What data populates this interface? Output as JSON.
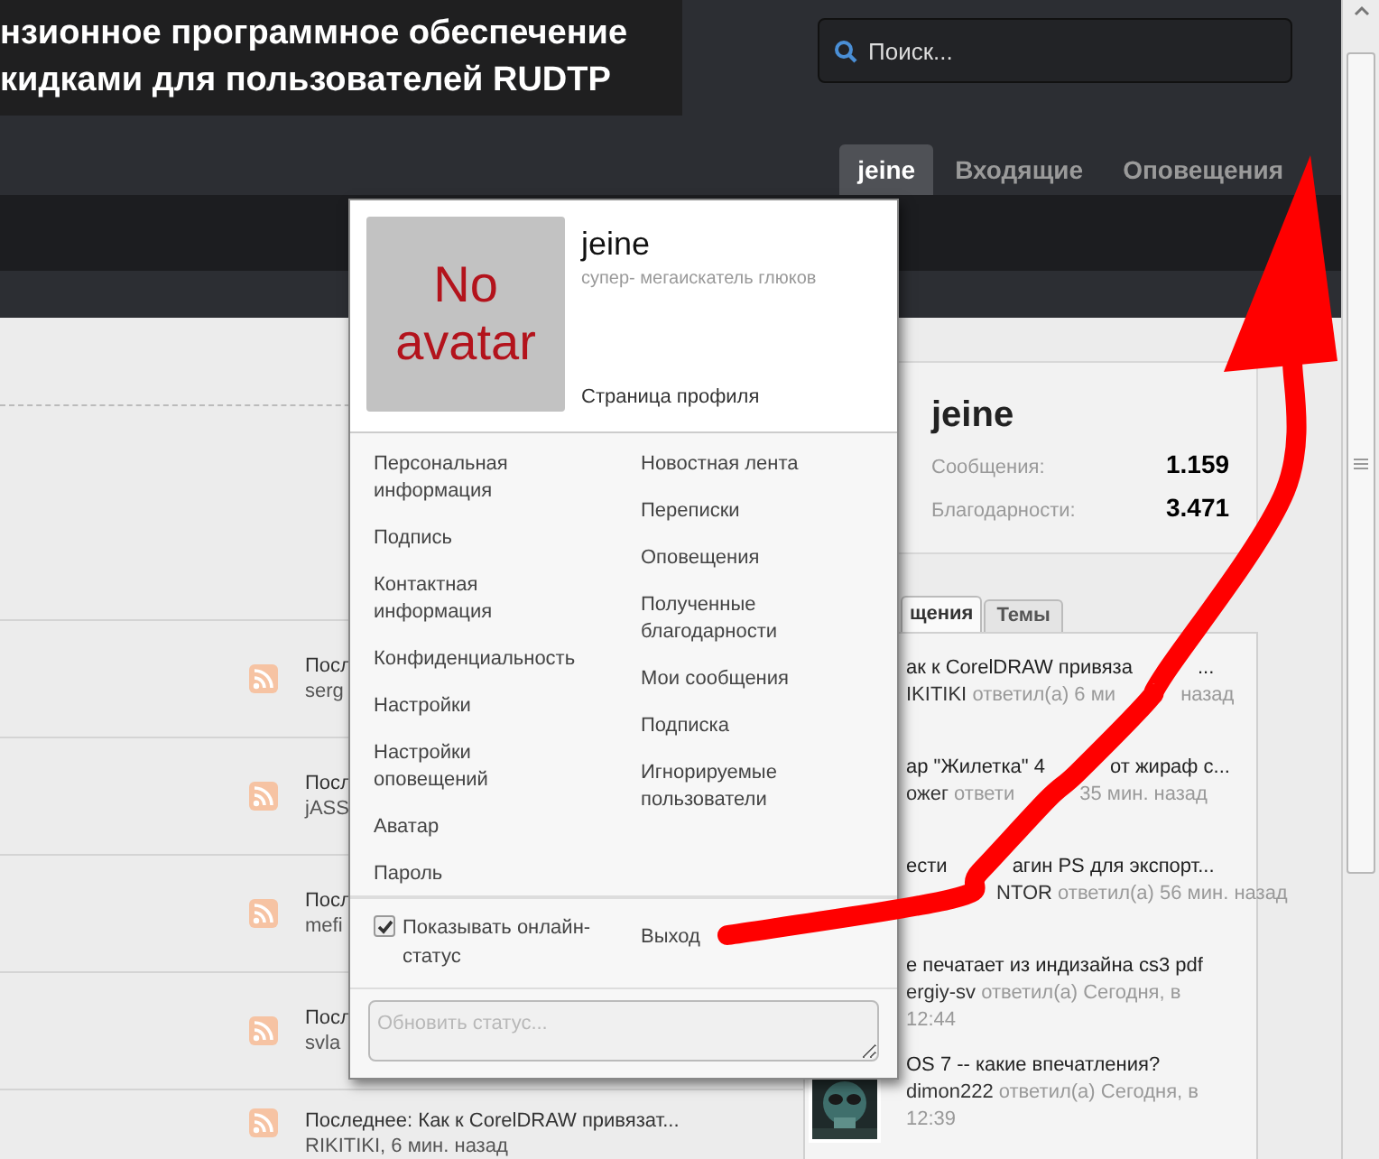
{
  "header": {
    "logo_lines": [
      "нзионное программное обеспечение",
      "кидками для пользователей RUDTP"
    ]
  },
  "search": {
    "placeholder": "Поиск..."
  },
  "nav_tabs": [
    {
      "label": "jeine",
      "selected": true
    },
    {
      "label": "Входящие",
      "selected": false
    },
    {
      "label": "Оповещения",
      "selected": false
    }
  ],
  "forum_rows": [
    {
      "line1": "Посл",
      "line2": "serg"
    },
    {
      "line1": "Посл",
      "line2": "jASS"
    },
    {
      "line1": "Посл",
      "line2": "mefi"
    },
    {
      "line1": "Посл",
      "line2": "svla"
    },
    {
      "line1": "Последнее: Как к CorelDRAW привязат...",
      "line2": "RIKITIKI, 6 мин. назад"
    }
  ],
  "profile_card": {
    "name": "jeine",
    "stats": [
      {
        "label": "Сообщения:",
        "value": "1.159"
      },
      {
        "label": "Благодарности:",
        "value": "3.471"
      }
    ]
  },
  "sidebar_tabs": [
    {
      "label": "щения",
      "selected": true
    },
    {
      "label": "Темы",
      "selected": false
    }
  ],
  "recent_threads": [
    {
      "title": [
        "ак к CorelDRAW привяза",
        "..."
      ],
      "user": "IKITIKI",
      "meta": [
        "ответил(а) 6 ми",
        "назад"
      ],
      "user_covered": false,
      "has_avatar": false
    },
    {
      "title": [
        "ар \"Жилетка\" 4",
        "от жираф с..."
      ],
      "user": "ожег",
      "meta": [
        "ответи",
        "35 мин. назад"
      ],
      "user_covered": false,
      "has_avatar": false
    },
    {
      "title": [
        "ести",
        "агин PS для экспорт..."
      ],
      "user": "NTOR",
      "meta": [
        "ответил(а) 56 мин. назад"
      ],
      "user_covered": true,
      "has_avatar": false
    },
    {
      "title": [
        "е печатает из индизайна cs3 pdf"
      ],
      "user": "ergiy-sv",
      "meta": [
        "ответил(а) Сегодня, в 12:44"
      ],
      "user_covered": false,
      "has_avatar": false
    },
    {
      "title": [
        "OS 7 -- какие впечатления?"
      ],
      "user": "dimon222",
      "meta": [
        "ответил(а) Сегодня, в 12:39"
      ],
      "user_covered": false,
      "has_avatar": true
    }
  ],
  "user_menu": {
    "avatar_lines": [
      "No",
      "avatar"
    ],
    "name": "jeine",
    "user_title": "супер- мегаискатель глюков",
    "profile_link": "Страница профиля",
    "left_links": [
      "Персональная информация",
      "Подпись",
      "Контактная информация",
      "Конфиденциальность",
      "Настройки",
      "Настройки оповещений",
      "Аватар",
      "Пароль"
    ],
    "right_links": [
      "Новостная лента",
      "Переписки",
      "Оповещения",
      "Полученные благодарности",
      "Мои сообщения",
      "Подписка",
      "Игнорируемые пользователи"
    ],
    "show_online": {
      "label": "Показывать онлайн-статус",
      "checked": true
    },
    "logout": "Выход",
    "status_placeholder": "Обновить статус..."
  }
}
